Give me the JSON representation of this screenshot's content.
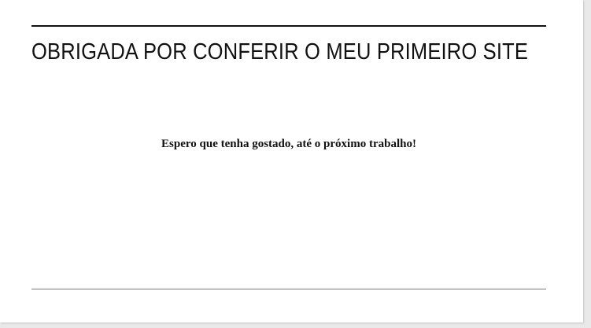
{
  "header": {
    "title": "OBRIGADA POR CONFERIR O MEU PRIMEIRO SITE"
  },
  "main": {
    "message": "Espero que tenha gostado, até o próximo trabalho!"
  },
  "colors": {
    "text": "#111111",
    "rule": "#777777",
    "background": "#ffffff"
  }
}
